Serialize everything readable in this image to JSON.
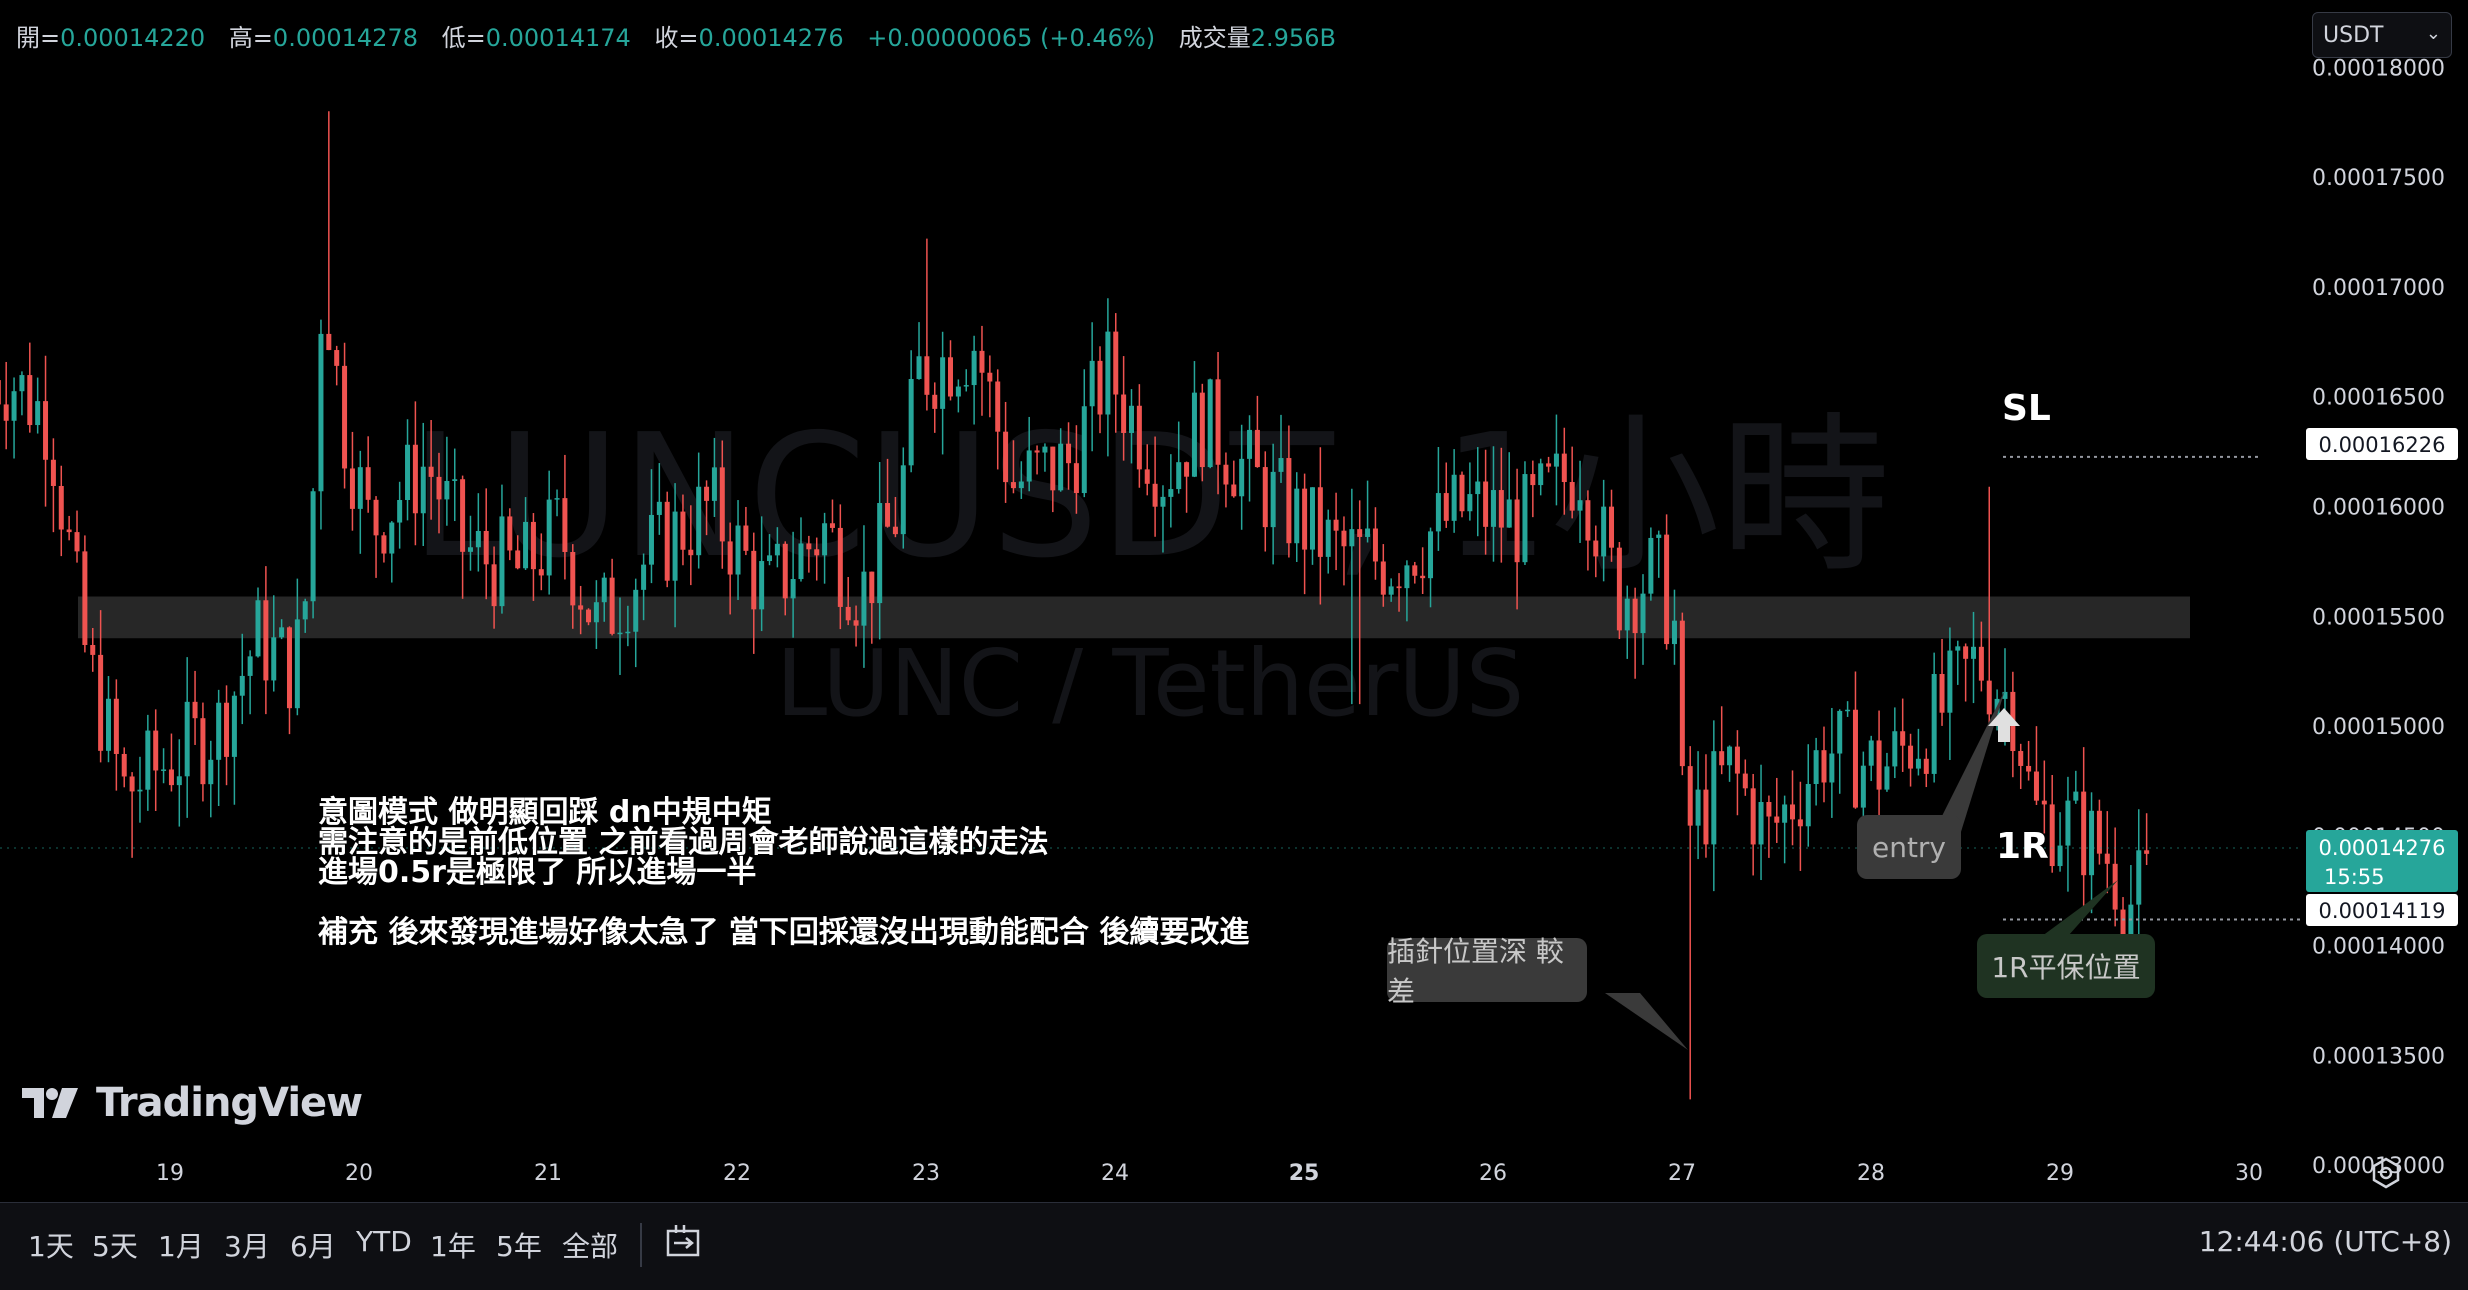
{
  "ohlc_bar": {
    "open_label": "開=",
    "open": "0.00014220",
    "high_label": "高=",
    "high": "0.00014278",
    "low_label": "低=",
    "low": "0.00014174",
    "close_label": "收=",
    "close": "0.00014276",
    "change": "+0.00000065 (+0.46%)",
    "volume_label": "成交量",
    "volume": "2.956B"
  },
  "currency_select": "USDT",
  "watermark": {
    "symbol": "LUNCUSDT, 1小時",
    "pair": "LUNC / TetherUS"
  },
  "logo": "TradingView",
  "notes": {
    "line1": "意圖模式 做明顯回踩 dn中規中矩",
    "line2": "需注意的是前低位置 之前看過周會老師說過這樣的走法",
    "line3": "進場0.5r是極限了 所以進場一半",
    "line4": "補充 後來發現進場好像太急了 當下回採還沒出現動能配合 後續要改進"
  },
  "callouts": {
    "wick": "插針位置深 較差",
    "entry": "entry",
    "breakeven": "1R平保位置",
    "sl": "SL",
    "r1": "1R"
  },
  "price_labels": {
    "sl_price": "0.00016226",
    "last_price": "0.00014276",
    "countdown": "15:55",
    "be_price": "0.00014119"
  },
  "time_ranges": [
    "1天",
    "5天",
    "1月",
    "3月",
    "6月",
    "YTD",
    "1年",
    "5年",
    "全部"
  ],
  "clock": "12:44:06 (UTC+8)",
  "icons": [
    "tradingview-logo-icon",
    "replay-icon",
    "gear-icon",
    "chevron-down-icon"
  ],
  "colors": {
    "up": "#26a69a",
    "down": "#ef5350",
    "background": "#000000"
  },
  "chart_data": {
    "type": "candlestick",
    "title": "LUNCUSDT, 1小時",
    "y_axis_ticks": [
      "0.00013000",
      "0.00013500",
      "0.00014000",
      "0.00014500",
      "0.00015000",
      "0.00015500",
      "0.00016000",
      "0.00016500",
      "0.00017000",
      "0.00017500",
      "0.00018000"
    ],
    "ylim": [
      0.0001296,
      0.0001817
    ],
    "x_axis_ticks": [
      "19",
      "20",
      "21",
      "22",
      "23",
      "24",
      "25",
      "26",
      "27",
      "28",
      "29",
      "30"
    ],
    "zone": {
      "from": 0.000154,
      "to": 0.0001559
    },
    "levels": {
      "sl": 0.00016226,
      "be": 0.00014119
    },
    "anchors": [
      {
        "d": 18.2,
        "p": 0.0001658
      },
      {
        "d": 18.4,
        "p": 0.000164
      },
      {
        "d": 18.6,
        "p": 0.000153
      },
      {
        "d": 18.8,
        "p": 0.000147
      },
      {
        "d": 19.0,
        "p": 0.0001482
      },
      {
        "d": 19.3,
        "p": 0.00015
      },
      {
        "d": 19.5,
        "p": 0.000154
      },
      {
        "d": 19.7,
        "p": 0.0001525
      },
      {
        "d": 19.78,
        "p": 0.000157
      },
      {
        "d": 19.85,
        "p": 0.000171
      },
      {
        "d": 19.95,
        "p": 0.000164
      },
      {
        "d": 20.1,
        "p": 0.000159
      },
      {
        "d": 20.4,
        "p": 0.000162
      },
      {
        "d": 20.6,
        "p": 0.000158
      },
      {
        "d": 20.9,
        "p": 0.000157
      },
      {
        "d": 21.1,
        "p": 0.000159
      },
      {
        "d": 21.3,
        "p": 0.0001545
      },
      {
        "d": 21.6,
        "p": 0.000158
      },
      {
        "d": 21.9,
        "p": 0.00016
      },
      {
        "d": 22.2,
        "p": 0.000156
      },
      {
        "d": 22.5,
        "p": 0.000159
      },
      {
        "d": 22.7,
        "p": 0.000156
      },
      {
        "d": 22.9,
        "p": 0.00016
      },
      {
        "d": 23.0,
        "p": 0.000166
      },
      {
        "d": 23.3,
        "p": 0.0001675
      },
      {
        "d": 23.5,
        "p": 0.000161
      },
      {
        "d": 23.8,
        "p": 0.000162
      },
      {
        "d": 24.0,
        "p": 0.0001662
      },
      {
        "d": 24.3,
        "p": 0.0001615
      },
      {
        "d": 24.5,
        "p": 0.000164
      },
      {
        "d": 24.8,
        "p": 0.000161
      },
      {
        "d": 25.2,
        "p": 0.000158
      },
      {
        "d": 25.5,
        "p": 0.0001575
      },
      {
        "d": 25.9,
        "p": 0.00016
      },
      {
        "d": 26.2,
        "p": 0.0001592
      },
      {
        "d": 26.5,
        "p": 0.000162
      },
      {
        "d": 26.7,
        "p": 0.000156
      },
      {
        "d": 26.9,
        "p": 0.000157
      },
      {
        "d": 27.0,
        "p": 0.0001548
      },
      {
        "d": 27.05,
        "p": 0.000145
      },
      {
        "d": 27.3,
        "p": 0.000148
      },
      {
        "d": 27.5,
        "p": 0.000145
      },
      {
        "d": 27.8,
        "p": 0.000149
      },
      {
        "d": 28.1,
        "p": 0.000148
      },
      {
        "d": 28.4,
        "p": 0.0001505
      },
      {
        "d": 28.6,
        "p": 0.000153
      },
      {
        "d": 28.8,
        "p": 0.000151
      },
      {
        "d": 28.9,
        "p": 0.000146
      },
      {
        "d": 29.1,
        "p": 0.0001455
      },
      {
        "d": 29.3,
        "p": 0.000144
      },
      {
        "d": 29.4,
        "p": 0.0001418
      },
      {
        "d": 29.5,
        "p": 0.0001428
      }
    ],
    "wicks": [
      {
        "d": 19.84,
        "high": 0.000178
      },
      {
        "d": 23.0,
        "high": 0.0001722
      },
      {
        "d": 25.27,
        "low": 0.000151
      },
      {
        "d": 27.05,
        "low": 0.000133
      },
      {
        "d": 28.64,
        "high": 0.0001609
      },
      {
        "d": 29.38,
        "low": 0.00014
      },
      {
        "d": 18.81,
        "low": 0.000144
      }
    ]
  }
}
